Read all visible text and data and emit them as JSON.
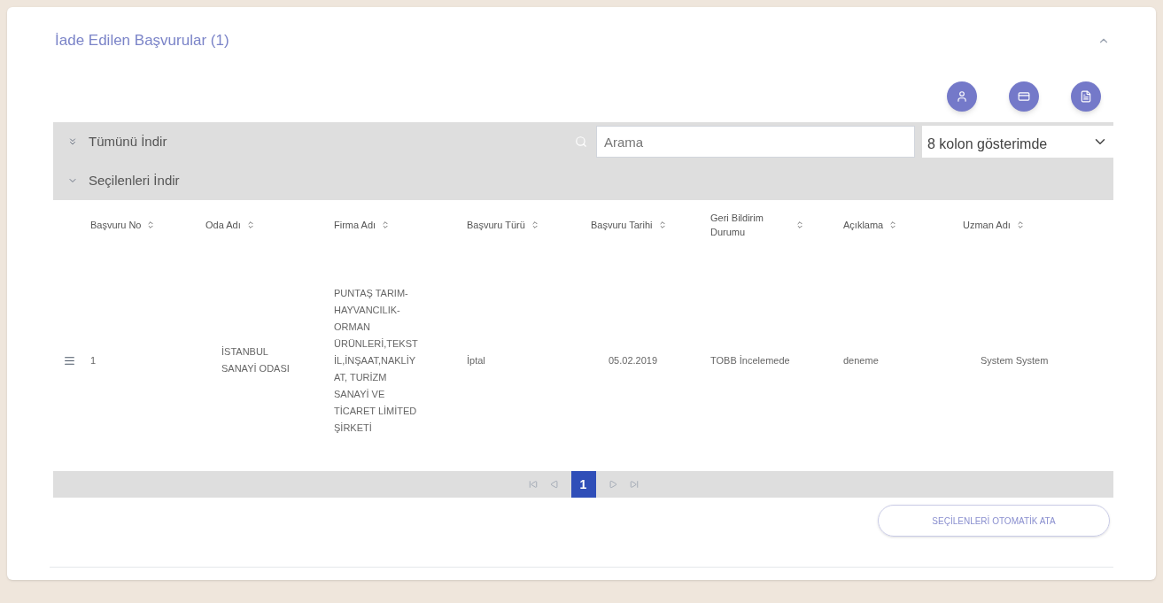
{
  "panel": {
    "title": "İade Edilen Başvurular (1)",
    "expanded": true
  },
  "toolbar": {
    "download_all": "Tümünü İndir",
    "download_selected": "Seçilenleri İndir",
    "search": {
      "placeholder": "Arama"
    },
    "columns_select": "8 kolon gösterimde"
  },
  "table": {
    "columns": [
      "Başvuru No",
      "Oda Adı",
      "Firma Adı",
      "Başvuru Türü",
      "Başvuru Tarihi",
      "Geri Bildirim Durumu",
      "Açıklama",
      "Uzman Adı"
    ],
    "rows": [
      {
        "cells": [
          "1",
          "İSTANBUL SANAYİ ODASI",
          "PUNTAŞ TARIM-HAYVANCILIK-ORMAN ÜRÜNLERİ,TEKSTİL,İNŞAAT,NAKLİYAT, TURİZM SANAYİ VE TİCARET LİMİTED ŞİRKETİ",
          "İptal",
          "05.02.2019",
          "TOBB İncelemede",
          "deneme",
          "System System"
        ]
      }
    ]
  },
  "pagination": {
    "pages": [
      {
        "label": "1",
        "selected": true
      }
    ]
  },
  "action_button": "SEÇİLENLERİ OTOMATİK ATA"
}
